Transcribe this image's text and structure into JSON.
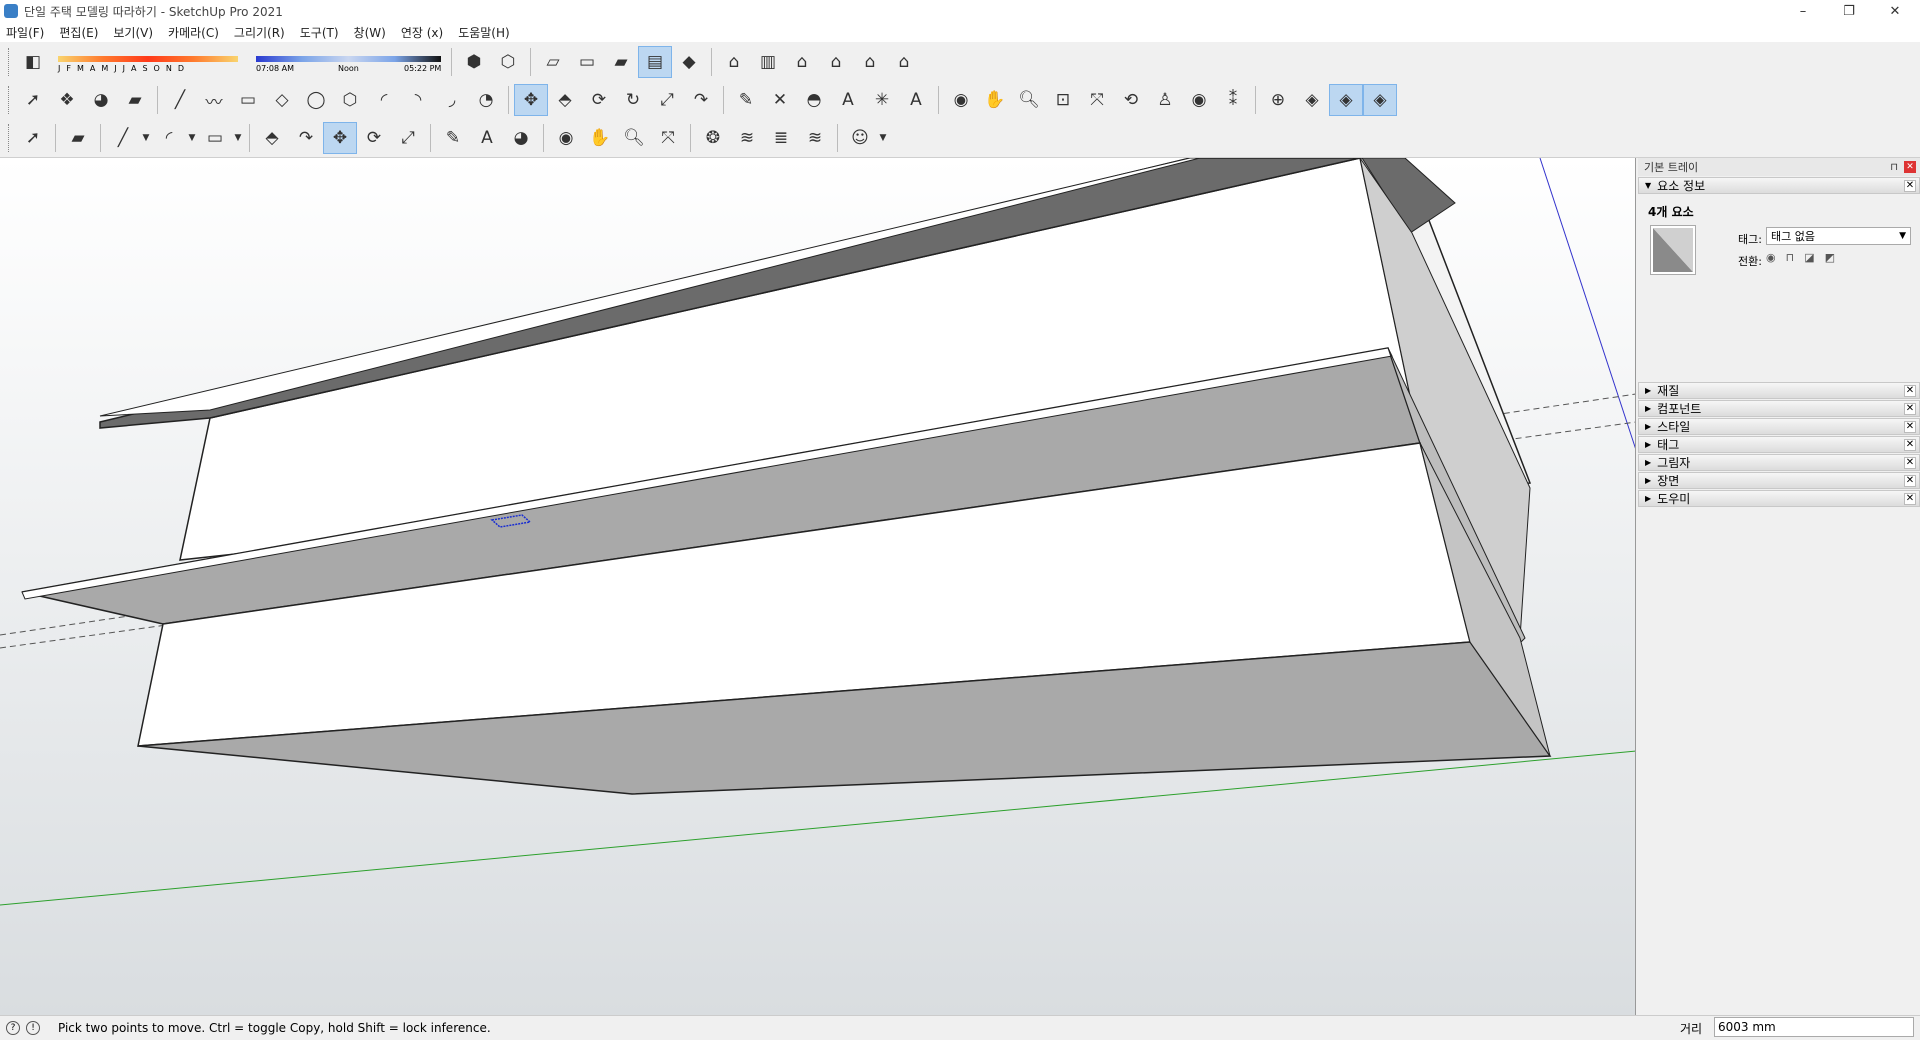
{
  "window": {
    "title": "단일 주택 모델링 따라하기 - SketchUp Pro 2021",
    "minimize": "–",
    "maximize": "❐",
    "close": "✕"
  },
  "menu": [
    "파일(F)",
    "편집(E)",
    "보기(V)",
    "카메라(C)",
    "그리기(R)",
    "도구(T)",
    "창(W)",
    "연장 (x)",
    "도움말(H)"
  ],
  "shadow": {
    "months": [
      "J",
      "F",
      "M",
      "A",
      "M",
      "J",
      "J",
      "A",
      "S",
      "O",
      "N",
      "D"
    ],
    "time_start": "07:08 AM",
    "time_mid": "Noon",
    "time_end": "05:22 PM"
  },
  "tray": {
    "title": "기본 트레이",
    "entity_panel": "요소 정보",
    "entity_count": "4개 요소",
    "tag_label": "태그:",
    "tag_value": "태그 없음",
    "toggle_label": "전환:",
    "panels": [
      "재질",
      "컴포넌트",
      "스타일",
      "태그",
      "그림자",
      "장면",
      "도우미"
    ]
  },
  "status": {
    "message": "Pick two points to move.  Ctrl = toggle Copy, hold Shift = lock inference.",
    "measure_label": "거리",
    "measure_value": "6003 mm"
  },
  "colors": {
    "active_tool": "#bcd7f1",
    "axis_green": "#2ca02c",
    "axis_blue": "#3333cc",
    "face_shade": "#a9a9a9",
    "face_dark": "#6b6b6b"
  }
}
